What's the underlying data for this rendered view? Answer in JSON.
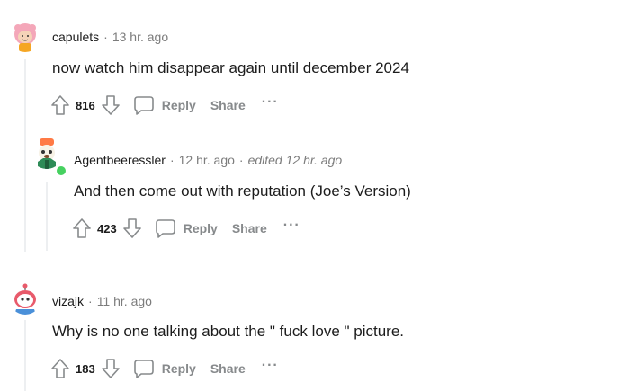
{
  "comments": [
    {
      "username": "capulets",
      "separator": "·",
      "time": "13 hr. ago",
      "text": "now watch him disappear again until december 2024",
      "score": "816",
      "reply_label": "Reply",
      "share_label": "Share",
      "more_label": "···"
    },
    {
      "username": "Agentbeeressler",
      "separator": "·",
      "time": "12 hr. ago",
      "separator2": "·",
      "edited": "edited 12 hr. ago",
      "text": "And then come out with reputation (Joe’s Version)",
      "score": "423",
      "reply_label": "Reply",
      "share_label": "Share",
      "more_label": "···"
    },
    {
      "username": "vizajk",
      "separator": "·",
      "time": "11 hr. ago",
      "text": "Why is no one talking about the \" fuck love \" picture.",
      "score": "183",
      "reply_label": "Reply",
      "share_label": "Share",
      "more_label": "···"
    }
  ],
  "icons": {
    "upvote": "arrow-up-outline",
    "downvote": "arrow-down-outline",
    "reply": "speech-bubble-outline",
    "online": "green-dot"
  },
  "colors": {
    "meta_gray": "#7c7c7c",
    "action_gray": "#878a8c",
    "thread_line": "#edeff1",
    "online": "#46d160"
  }
}
